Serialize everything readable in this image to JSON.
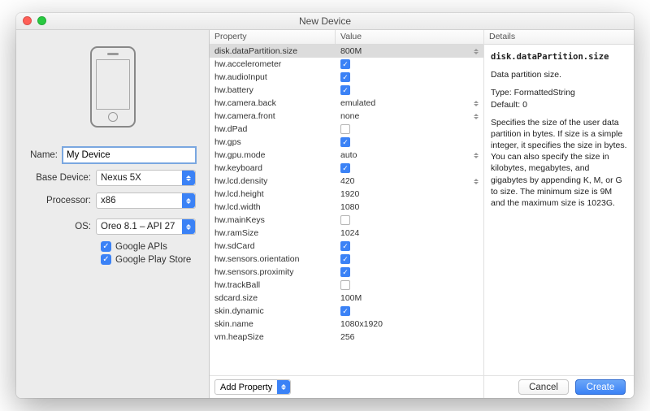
{
  "window": {
    "title": "New Device"
  },
  "side": {
    "name_label": "Name:",
    "name_value": "My Device",
    "base_label": "Base Device:",
    "base_value": "Nexus 5X",
    "proc_label": "Processor:",
    "proc_value": "x86",
    "os_label": "OS:",
    "os_value": "Oreo 8.1 – API 27",
    "google_apis_label": "Google APIs",
    "google_play_label": "Google Play Store"
  },
  "columns": {
    "property": "Property",
    "value": "Value",
    "details": "Details"
  },
  "rows": [
    {
      "k": "disk.dataPartition.size",
      "type": "text",
      "v": "800M",
      "stepper": true,
      "selected": true
    },
    {
      "k": "hw.accelerometer",
      "type": "check",
      "on": true
    },
    {
      "k": "hw.audioInput",
      "type": "check",
      "on": true
    },
    {
      "k": "hw.battery",
      "type": "check",
      "on": true
    },
    {
      "k": "hw.camera.back",
      "type": "text",
      "v": "emulated",
      "stepper": true
    },
    {
      "k": "hw.camera.front",
      "type": "text",
      "v": "none",
      "stepper": true
    },
    {
      "k": "hw.dPad",
      "type": "check",
      "on": false
    },
    {
      "k": "hw.gps",
      "type": "check",
      "on": true
    },
    {
      "k": "hw.gpu.mode",
      "type": "text",
      "v": "auto",
      "stepper": true
    },
    {
      "k": "hw.keyboard",
      "type": "check",
      "on": true
    },
    {
      "k": "hw.lcd.density",
      "type": "text",
      "v": "420",
      "stepper": true
    },
    {
      "k": "hw.lcd.height",
      "type": "text",
      "v": "1920"
    },
    {
      "k": "hw.lcd.width",
      "type": "text",
      "v": "1080"
    },
    {
      "k": "hw.mainKeys",
      "type": "check",
      "on": false
    },
    {
      "k": "hw.ramSize",
      "type": "text",
      "v": "1024"
    },
    {
      "k": "hw.sdCard",
      "type": "check",
      "on": true
    },
    {
      "k": "hw.sensors.orientation",
      "type": "check",
      "on": true
    },
    {
      "k": "hw.sensors.proximity",
      "type": "check",
      "on": true
    },
    {
      "k": "hw.trackBall",
      "type": "check",
      "on": false
    },
    {
      "k": "sdcard.size",
      "type": "text",
      "v": "100M"
    },
    {
      "k": "skin.dynamic",
      "type": "check",
      "on": true
    },
    {
      "k": "skin.name",
      "type": "text",
      "v": "1080x1920"
    },
    {
      "k": "vm.heapSize",
      "type": "text",
      "v": "256"
    }
  ],
  "addprop_label": "Add Property",
  "details": {
    "name": "disk.dataPartition.size",
    "summary": "Data partition size.",
    "type_line": "Type: FormattedString",
    "default_line": "Default: 0",
    "desc": "Specifies the size of the user data partition in bytes. If size is a simple integer, it specifies the size in bytes. You can also specify the size in kilobytes, megabytes, and gigabytes by appending K, M, or G to size. The minimum size is 9M and the maximum size is 1023G."
  },
  "footer": {
    "cancel": "Cancel",
    "create": "Create"
  }
}
